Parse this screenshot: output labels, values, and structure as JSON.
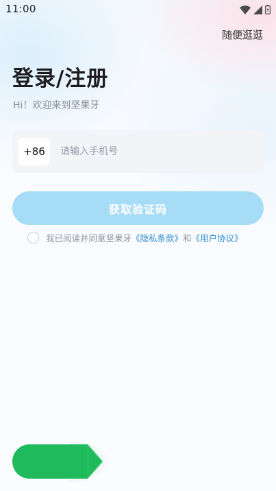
{
  "status_bar": {
    "time": "11:00",
    "icons": [
      "wifi-icon",
      "signal-icon",
      "battery-icon"
    ]
  },
  "header": {
    "browse_link": "随便逛逛"
  },
  "main": {
    "title": "登录/注册",
    "subtitle": "Hi！欢迎来到坚果牙",
    "country_code": "+86",
    "phone_placeholder": "请输入手机号",
    "phone_value": "",
    "submit_label": "获取验证码"
  },
  "agreement": {
    "checked": false,
    "prefix": "我已阅读并同意坚果牙",
    "privacy_link": "《隐私条款》",
    "conjunction": "和",
    "user_link": "《用户协议》"
  },
  "colors": {
    "button": "#a7dcf7",
    "link": "#2f8ccf",
    "pill": "#1fba5c",
    "input_bg": "#f3f4f8"
  }
}
